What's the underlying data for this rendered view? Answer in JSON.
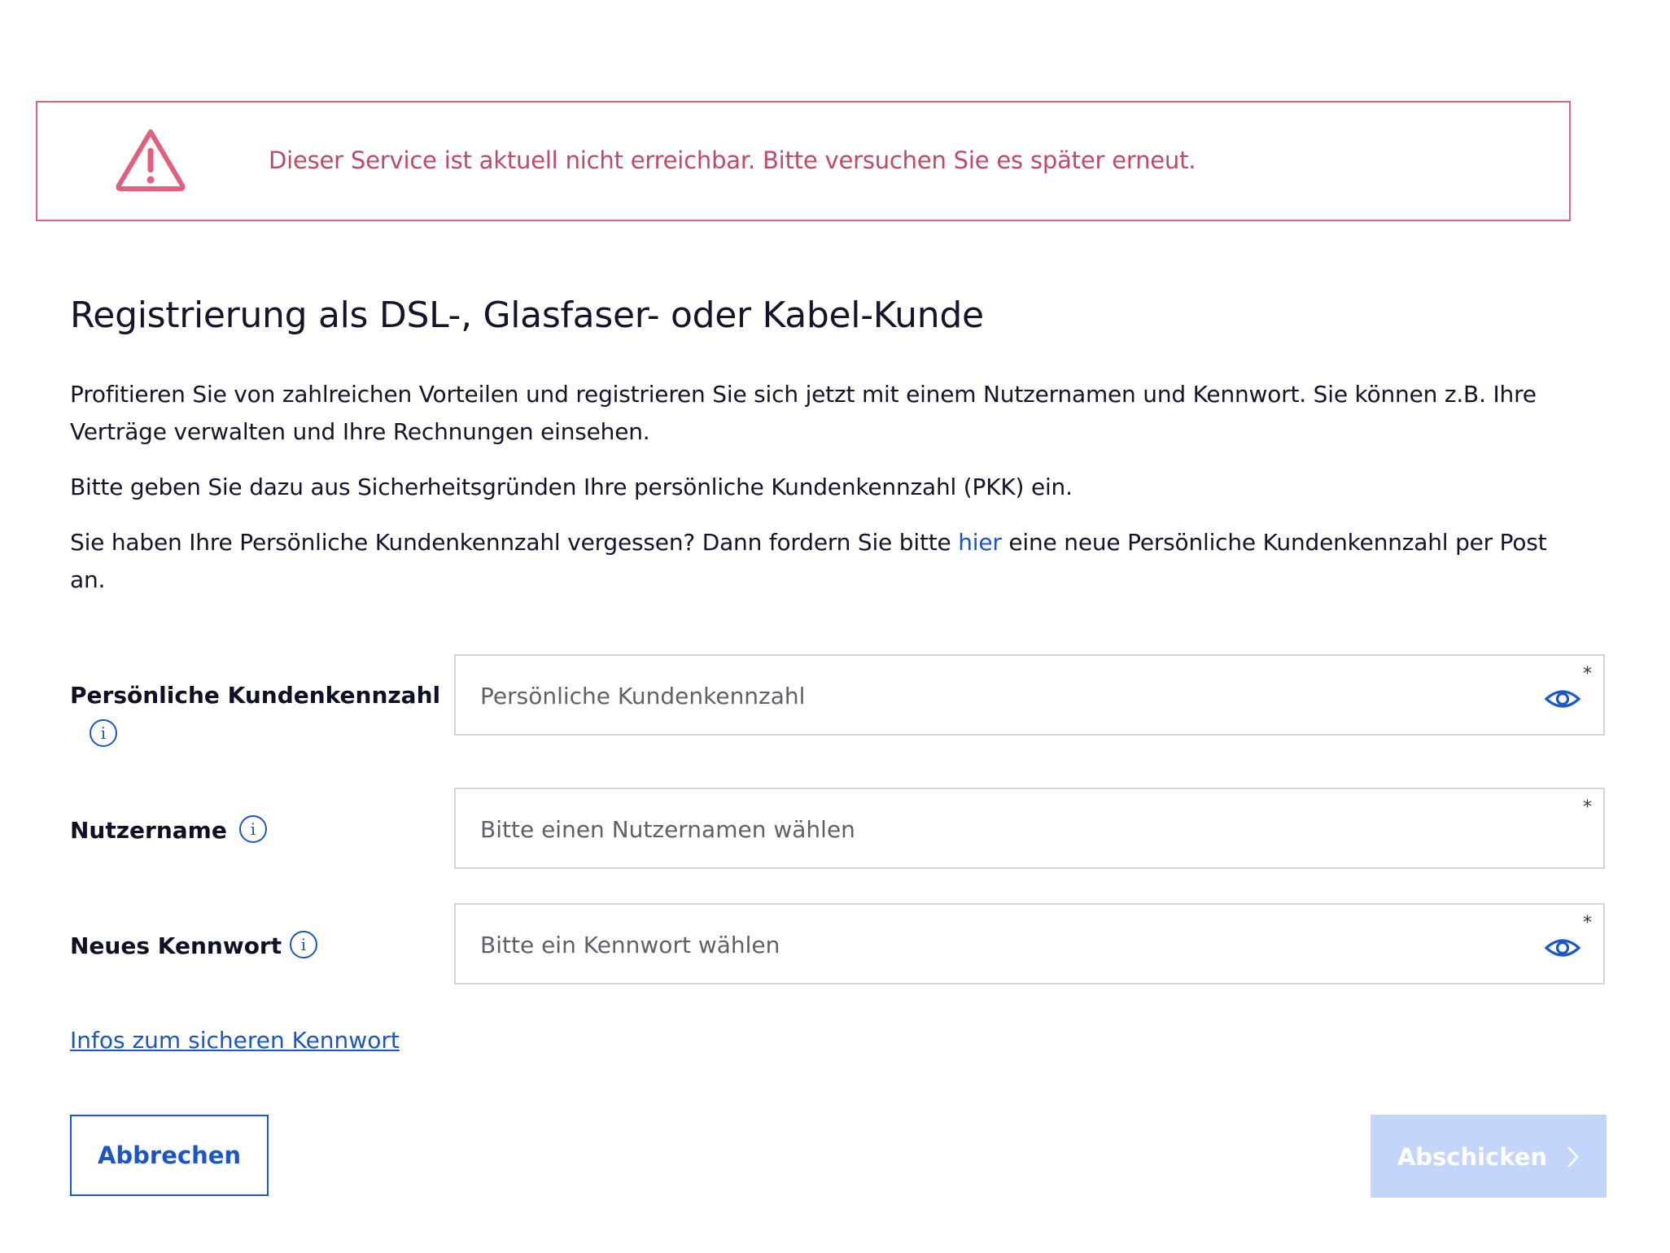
{
  "alert": {
    "message": "Dieser Service ist aktuell nicht erreichbar. Bitte versuchen Sie es später erneut.",
    "color": "#e0607e",
    "icon": "warning-triangle-icon"
  },
  "page": {
    "title": "Registrierung als DSL-, Glasfaser- oder Kabel-Kunde",
    "intro": "Profitieren Sie von zahlreichen Vorteilen und registrieren Sie sich jetzt mit einem Nutzernamen und Kennwort. Sie können z.B. Ihre Verträge verwalten und Ihre Rechnungen einsehen.",
    "pkk_hint": "Bitte geben Sie dazu aus Sicherheitsgründen Ihre persönliche Kundenkennzahl (PKK) ein.",
    "forgot_before": "Sie haben Ihre Persönliche Kundenkennzahl vergessen? Dann fordern Sie bitte ",
    "forgot_link": "hier",
    "forgot_after": " eine neue Persönliche Kundenkennzahl per Post an."
  },
  "form": {
    "pkk": {
      "label": "Persönliche Kundenkennzahl",
      "placeholder": "Persönliche Kundenkennzahl",
      "value": "",
      "required_marker": "*"
    },
    "username": {
      "label": "Nutzername",
      "placeholder": "Bitte einen Nutzernamen wählen",
      "value": "",
      "required_marker": "*"
    },
    "password": {
      "label": "Neues Kennwort",
      "placeholder": "Bitte ein Kennwort wählen",
      "value": "",
      "required_marker": "*"
    },
    "info_glyph": "i",
    "password_info_link": "Infos zum sicheren Kennwort"
  },
  "buttons": {
    "cancel": "Abbrechen",
    "submit": "Abschicken",
    "submit_disabled": true
  },
  "colors": {
    "accent": "#1a56c4",
    "alert": "#e0607e",
    "alert_text": "#c04a66",
    "submit_disabled_bg": "#c3d5fb"
  }
}
